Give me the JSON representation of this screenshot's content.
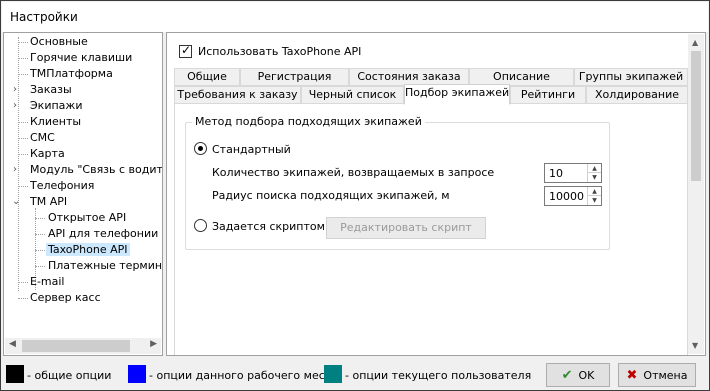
{
  "window": {
    "title": "Настройки"
  },
  "tree": {
    "items": [
      {
        "label": "Основные"
      },
      {
        "label": "Горячие клавиши"
      },
      {
        "label": "ТМПлатформа"
      },
      {
        "label": "Заказы"
      },
      {
        "label": "Экипажи"
      },
      {
        "label": "Клиенты"
      },
      {
        "label": "СМС"
      },
      {
        "label": "Карта"
      },
      {
        "label": "Модуль \"Связь с водителя"
      },
      {
        "label": "Телефония"
      },
      {
        "label": "TM API"
      },
      {
        "label": "Открытое API"
      },
      {
        "label": "API для телефонии"
      },
      {
        "label": "TaxoPhone API"
      },
      {
        "label": "Платежные терминалы"
      },
      {
        "label": "E-mail"
      },
      {
        "label": "Сервер касс"
      }
    ]
  },
  "pane": {
    "use_api_checkbox": {
      "label": "Использовать TaxoPhone API",
      "checked": true
    },
    "tabs_row1": [
      "Общие",
      "Регистрация",
      "Состояния заказа",
      "Описание",
      "Группы экипажей"
    ],
    "tabs_row2": [
      "Требования к заказу",
      "Черный список",
      "Подбор экипажей",
      "Рейтинги",
      "Холдирование"
    ],
    "active_tab": "Подбор экипажей",
    "group": {
      "title": "Метод подбора подходящих экипажей",
      "standard_label": "Стандартный",
      "count_label": "Количество экипажей, возвращаемых в запросе",
      "count_value": "10",
      "radius_label": "Радиус поиска подходящих экипажей, м",
      "radius_value": "10000",
      "script_label": "Задается скриптом",
      "edit_script_button": "Редактировать скрипт",
      "selected_method": "Стандартный"
    }
  },
  "footer": {
    "legend": [
      {
        "label": "- общие опции",
        "color": "#000000"
      },
      {
        "label": "- опции данного рабочего места",
        "color": "#0000ff"
      },
      {
        "label": "- опции текущего пользователя",
        "color": "#008080"
      }
    ],
    "ok_label": "OK",
    "cancel_label": "Отмена"
  }
}
